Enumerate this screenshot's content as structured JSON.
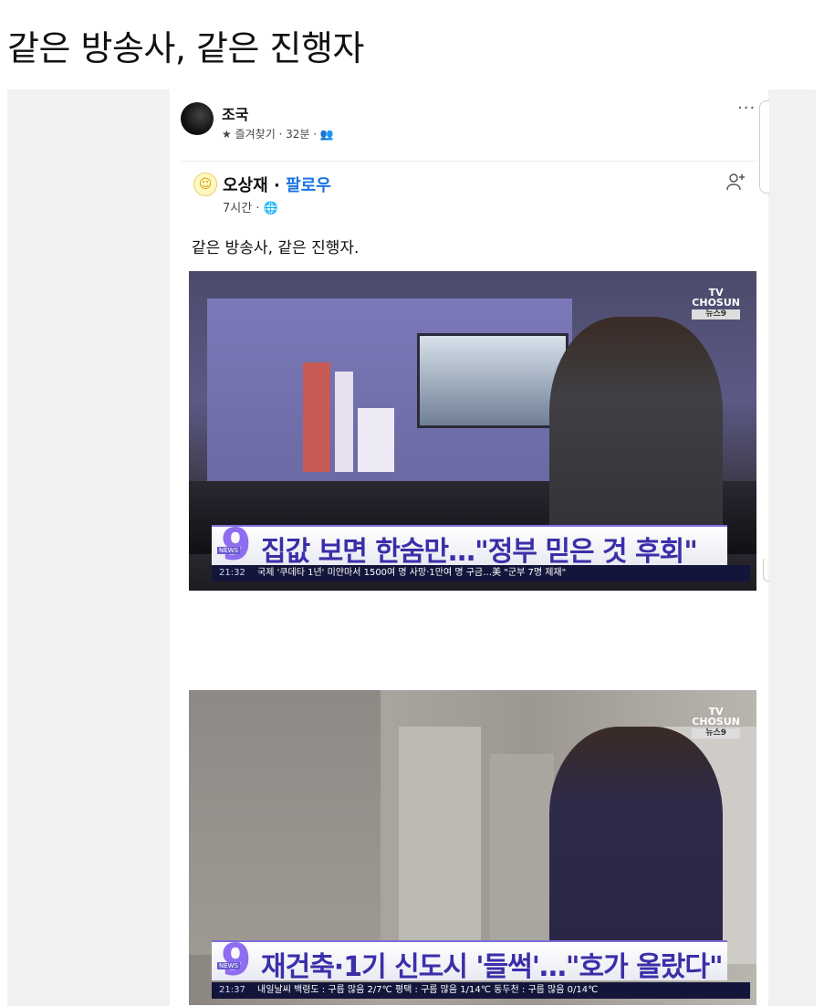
{
  "page": {
    "title": "같은 방송사, 같은 진행자"
  },
  "post": {
    "author": "조국",
    "meta": "★ 즐겨찾기 · 32분 · 👥",
    "more_label": "···"
  },
  "shared": {
    "author": "오상재",
    "separator": "·",
    "follow_label": "팔로우",
    "meta": "7시간 · 🌐",
    "text": "같은 방송사, 같은 진행자.",
    "add_friend_icon": "person-add-icon"
  },
  "broadcast": {
    "logo_top": "TV",
    "logo_name": "CHOSUN",
    "logo_sub": "뉴스9",
    "number": "9",
    "news_tag": "NEWS"
  },
  "frames": [
    {
      "headline": "집값 보면 한숨만…\"정부 믿은 것 후회\"",
      "time": "21:32",
      "crawl": "국제  '쿠데타 1년' 미얀마서 1500여 명 사망·1만여 명 구금…美 \"군부 7명 제재\""
    },
    {
      "headline": "재건축·1기 신도시 '들썩'…\"호가 올랐다\"",
      "time": "21:37",
      "crawl": "내일날씨   백령도 : 구름 많음 2/7℃   평택 : 구름 많음 1/14℃   동두천 : 구름 많음 0/14℃"
    }
  ],
  "colors": {
    "accent": "#1b74e4",
    "headline": "#3a2fa8",
    "crawl_bg": "#13163a",
    "number": "#8e6df0"
  }
}
